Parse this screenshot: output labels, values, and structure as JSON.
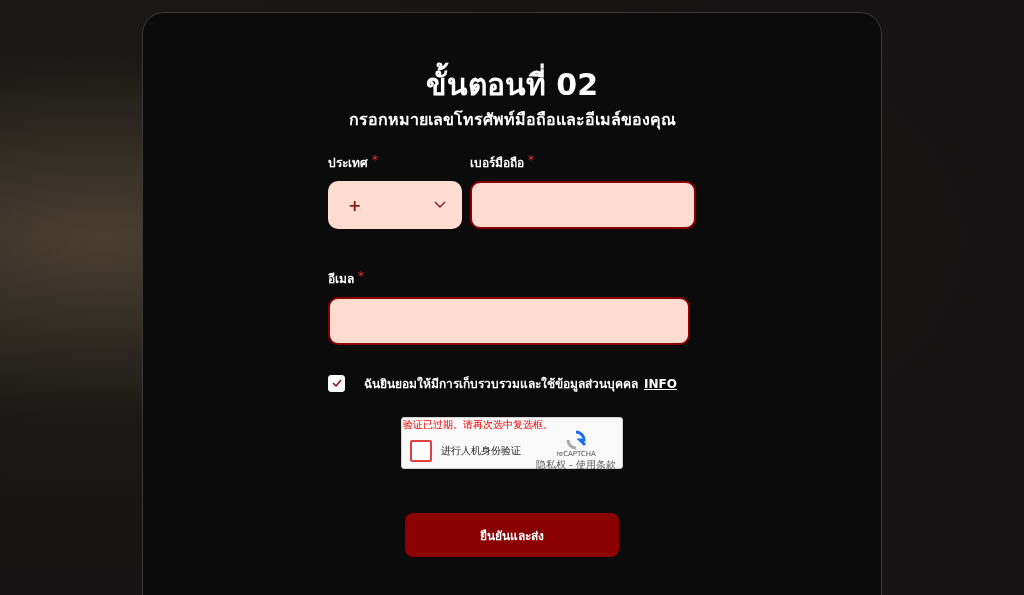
{
  "step": {
    "title": "ขั้นตอนที่ 02",
    "subtitle": "กรอกหมายเลขโทรศัพท์มือถือและอีเมล์ของคุณ"
  },
  "country": {
    "label": "ประเทศ",
    "required_mark": "*",
    "value": "+"
  },
  "phone": {
    "label": "เบอร์มือถือ",
    "required_mark": "*"
  },
  "email": {
    "label": "อีเมล",
    "required_mark": "*"
  },
  "consent": {
    "checked": true,
    "text": "ฉันยินยอมให้มีการเก็บรวบรวมและใช้ข้อมูลส่วนบุคคล",
    "link": "INFO"
  },
  "captcha": {
    "error": "验证已过期。请再次选中复选框。",
    "checked": false,
    "label": "进行人机身份验证",
    "brand": "reCAPTCHA",
    "terms": "隐私权 - 使用条款"
  },
  "submit": "ยืนยันและส่ง"
}
